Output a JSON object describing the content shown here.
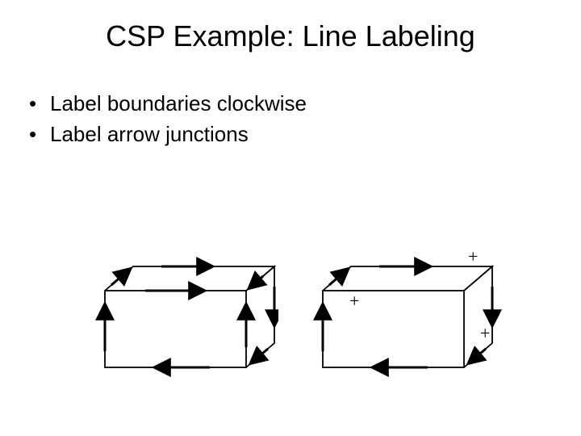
{
  "title": "CSP Example: Line Labeling",
  "bullets": [
    "Label boundaries clockwise",
    "Label arrow junctions"
  ],
  "labels": {
    "plus": "+"
  }
}
